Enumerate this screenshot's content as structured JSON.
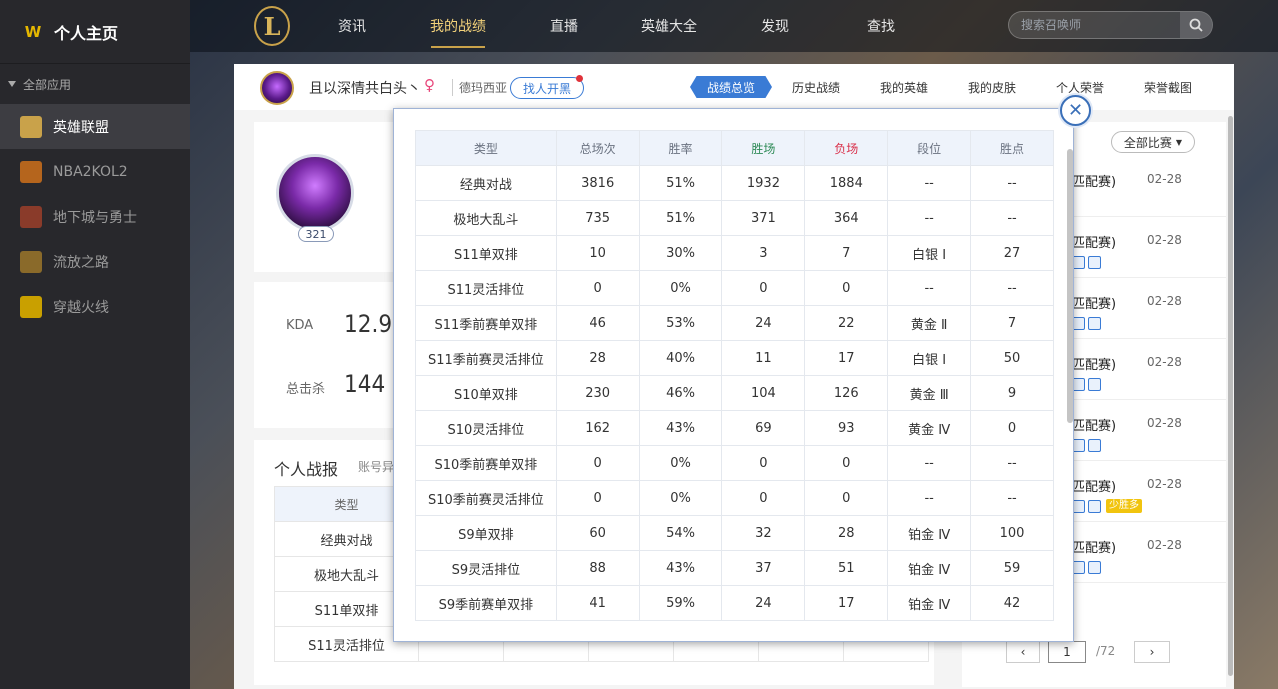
{
  "sidebar": {
    "header": "个人主页",
    "section": "全部应用",
    "items": [
      {
        "label": "英雄联盟",
        "icon": "lol-icon",
        "color": "#c9a24a",
        "active": true
      },
      {
        "label": "NBA2KOL2",
        "icon": "nba-icon",
        "color": "#b5651d",
        "active": false
      },
      {
        "label": "地下城与勇士",
        "icon": "dnf-icon",
        "color": "#8a3b2a",
        "active": false
      },
      {
        "label": "流放之路",
        "icon": "poe-icon",
        "color": "#8a6a2a",
        "active": false
      },
      {
        "label": "穿越火线",
        "icon": "cf-icon",
        "color": "#c9a000",
        "active": false
      }
    ]
  },
  "topnav": {
    "items": [
      "资讯",
      "我的战绩",
      "直播",
      "英雄大全",
      "发现",
      "查找"
    ],
    "active_index": 1,
    "search_placeholder": "搜索召唤师"
  },
  "profile": {
    "name": "且以深情共白头丶",
    "server": "德玛西亚",
    "find_button": "找人开黑",
    "name_fragment": "且",
    "server_fragment": "德玛",
    "level": "321",
    "tabs": [
      "战绩总览",
      "历史战绩",
      "我的英雄",
      "我的皮肤",
      "个人荣誉",
      "荣誉截图"
    ],
    "active_tab": 0
  },
  "stats": {
    "kda_label": "KDA",
    "kda_value": "12.9",
    "kills_label": "总击杀",
    "kills_value": "144"
  },
  "report": {
    "title": "个人战报",
    "subtitle": "账号异",
    "header": "类型",
    "rows": [
      "经典对战",
      "极地大乱斗",
      "S11单双排",
      "S11灵活排位"
    ]
  },
  "right_panel": {
    "filter_label": "全部比赛",
    "matches": [
      {
        "mode": "匹配赛)",
        "date": "02-28",
        "tag": ""
      },
      {
        "mode": "匹配赛)",
        "date": "02-28",
        "tag": ""
      },
      {
        "mode": "匹配赛)",
        "date": "02-28",
        "tag": ""
      },
      {
        "mode": "匹配赛)",
        "date": "02-28",
        "tag": ""
      },
      {
        "mode": "匹配赛)",
        "date": "02-28",
        "tag": ""
      },
      {
        "mode": "匹配赛)",
        "date": "02-28",
        "tag": "少胜多"
      },
      {
        "mode": "匹配赛)",
        "date": "02-28",
        "tag": ""
      }
    ],
    "pager": {
      "current": "1",
      "total": "/72"
    }
  },
  "modal": {
    "headers": [
      "类型",
      "总场次",
      "胜率",
      "胜场",
      "负场",
      "段位",
      "胜点"
    ],
    "header_colors": {
      "wins": "#2e8b57",
      "losses": "#d9304a"
    },
    "rows": [
      [
        "经典对战",
        "3816",
        "51%",
        "1932",
        "1884",
        "--",
        "--"
      ],
      [
        "极地大乱斗",
        "735",
        "51%",
        "371",
        "364",
        "--",
        "--"
      ],
      [
        "S11单双排",
        "10",
        "30%",
        "3",
        "7",
        "白银 Ⅰ",
        "27"
      ],
      [
        "S11灵活排位",
        "0",
        "0%",
        "0",
        "0",
        "--",
        "--"
      ],
      [
        "S11季前赛单双排",
        "46",
        "53%",
        "24",
        "22",
        "黄金 Ⅱ",
        "7"
      ],
      [
        "S11季前赛灵活排位",
        "28",
        "40%",
        "11",
        "17",
        "白银 Ⅰ",
        "50"
      ],
      [
        "S10单双排",
        "230",
        "46%",
        "104",
        "126",
        "黄金 Ⅲ",
        "9"
      ],
      [
        "S10灵活排位",
        "162",
        "43%",
        "69",
        "93",
        "黄金 Ⅳ",
        "0"
      ],
      [
        "S10季前赛单双排",
        "0",
        "0%",
        "0",
        "0",
        "--",
        "--"
      ],
      [
        "S10季前赛灵活排位",
        "0",
        "0%",
        "0",
        "0",
        "--",
        "--"
      ],
      [
        "S9单双排",
        "60",
        "54%",
        "32",
        "28",
        "铂金 Ⅳ",
        "100"
      ],
      [
        "S9灵活排位",
        "88",
        "43%",
        "37",
        "51",
        "铂金 Ⅳ",
        "59"
      ],
      [
        "S9季前赛单双排",
        "41",
        "59%",
        "24",
        "17",
        "铂金 Ⅳ",
        "42"
      ]
    ]
  }
}
